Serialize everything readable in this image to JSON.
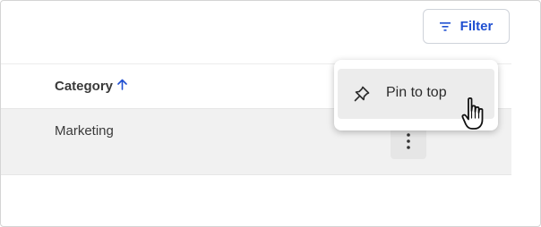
{
  "toolbar": {
    "filter_label": "Filter",
    "filter_icon": "filter-lines-icon"
  },
  "table": {
    "columns": [
      {
        "label": "Category",
        "sort": "ascending",
        "sort_icon": "arrow-up-icon"
      }
    ],
    "rows": [
      {
        "category": "Marketing",
        "actions_icon": "kebab-vertical-icon"
      }
    ]
  },
  "context_menu": {
    "items": [
      {
        "label": "Pin to top",
        "icon": "pushpin-icon"
      }
    ]
  },
  "colors": {
    "accent": "#1f4fd1",
    "row_highlight": "#f1f1f1",
    "menu_hover": "#ececec"
  }
}
